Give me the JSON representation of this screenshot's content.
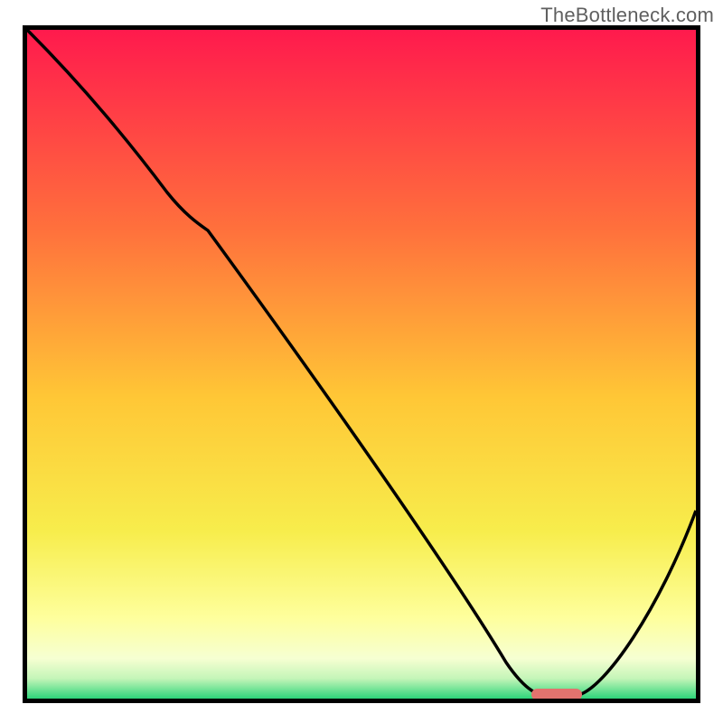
{
  "watermark": "TheBottleneck.com",
  "chart_data": {
    "type": "line",
    "title": "",
    "xlabel": "",
    "ylabel": "",
    "xlim": [
      0,
      100
    ],
    "ylim": [
      0,
      100
    ],
    "grid": false,
    "legend": false,
    "background": {
      "type": "vertical-gradient",
      "stops": [
        {
          "offset": 0,
          "color": "#ff1a4d"
        },
        {
          "offset": 30,
          "color": "#ff713c"
        },
        {
          "offset": 55,
          "color": "#ffc736"
        },
        {
          "offset": 75,
          "color": "#f7ed4c"
        },
        {
          "offset": 88,
          "color": "#feff9d"
        },
        {
          "offset": 94,
          "color": "#f6ffd2"
        },
        {
          "offset": 97,
          "color": "#c4f5b8"
        },
        {
          "offset": 100,
          "color": "#2dd57a"
        }
      ]
    },
    "series": [
      {
        "name": "bottleneck-curve",
        "x": [
          0,
          5,
          10,
          15,
          20,
          25,
          30,
          35,
          40,
          45,
          50,
          55,
          60,
          65,
          70,
          74,
          78,
          82,
          86,
          90,
          94,
          98,
          100
        ],
        "y": [
          100,
          93,
          86,
          80,
          75,
          72,
          65,
          57,
          49,
          41,
          33,
          25,
          17,
          10,
          4,
          1,
          0,
          0,
          3,
          9,
          16,
          24,
          28
        ]
      }
    ],
    "marker": {
      "name": "optimal-range",
      "x_start": 76,
      "x_end": 82,
      "y": 0,
      "color": "#e2736e"
    }
  }
}
